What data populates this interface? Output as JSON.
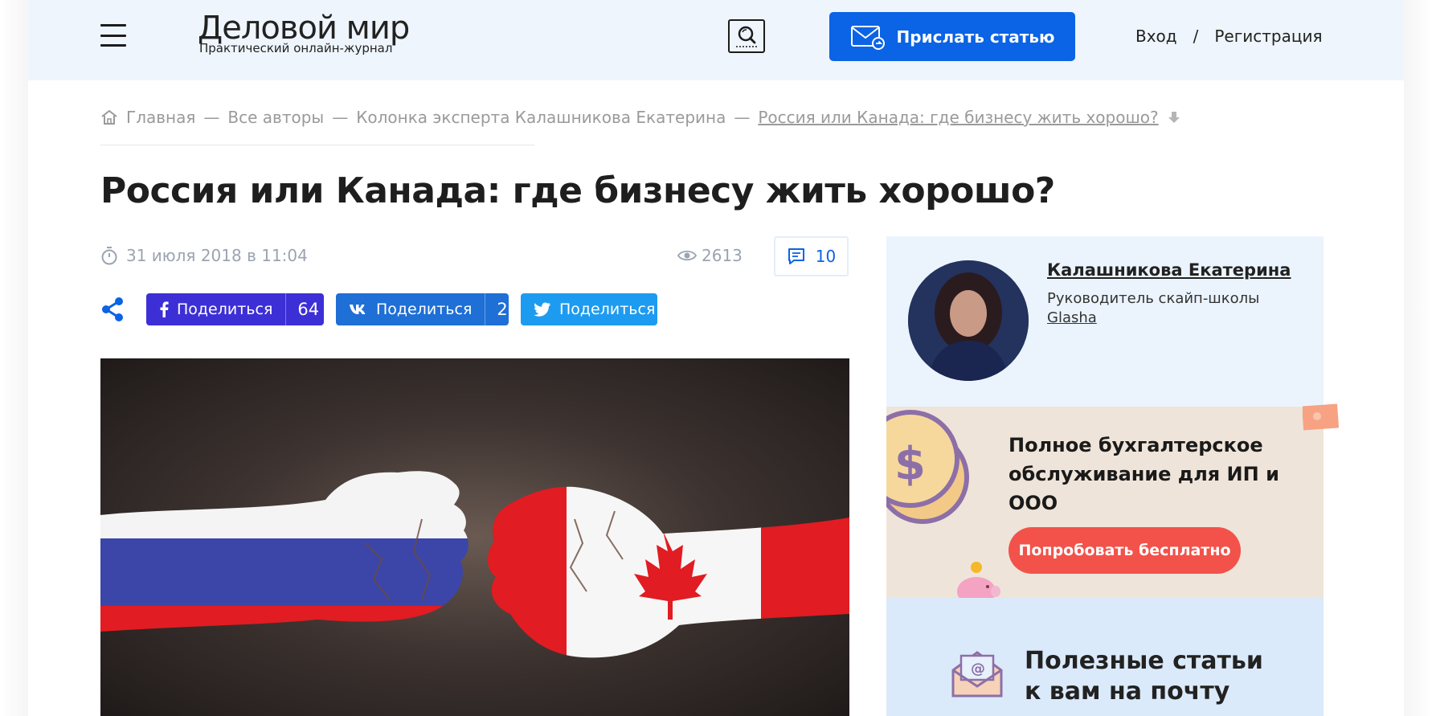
{
  "header": {
    "logo_title": "Деловой мир",
    "logo_subtitle": "Практический онлайн-журнал",
    "send_article_label": "Прислать статью",
    "login_label": "Вход",
    "auth_separator": "/",
    "register_label": "Регистрация"
  },
  "breadcrumb": {
    "items": [
      "Главная",
      "Все авторы",
      "Колонка эксперта Калашникова Екатерина"
    ],
    "separator": "—",
    "current": "Россия или Канада: где бизнесу жить хорошо?"
  },
  "article": {
    "title": "Россия или Канада: где бизнесу жить хорошо?",
    "date": "31 июля 2018 в 11:04",
    "views": "2613",
    "comments": "10"
  },
  "share": {
    "facebook_label": "Поделиться",
    "facebook_count": "64",
    "vk_label": "Поделиться",
    "vk_count": "2",
    "twitter_label": "Поделиться"
  },
  "author": {
    "name": "Калашникова Екатерина",
    "role": "Руководитель скайп-школы",
    "company": "Glasha"
  },
  "ad": {
    "text": "Полное бухгалтерское обслуживание для ИП и ООО",
    "button_label": "Попробовать бесплатно"
  },
  "subscribe": {
    "line1": "Полезные статьи",
    "line2": "к вам на почту"
  },
  "colors": {
    "accent_blue": "#0b63e5",
    "facebook": "#3d2fd6",
    "vk": "#1e6fd6",
    "twitter": "#1d9bf0",
    "ad_button": "#f2524a"
  }
}
